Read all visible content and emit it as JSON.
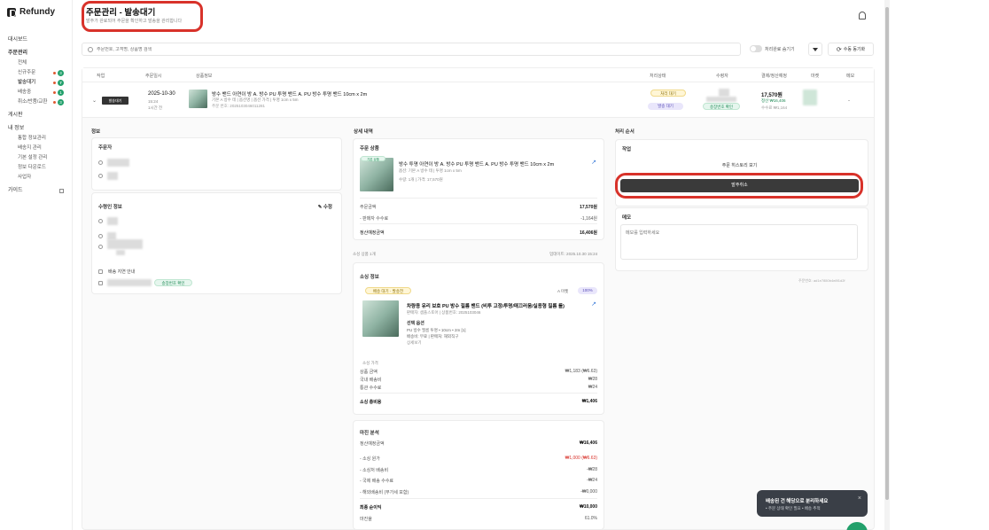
{
  "app": {
    "name": "Refundy"
  },
  "header": {
    "title": "주문관리 - 발송대기",
    "subtitle": "발주가 완료되어 주문을 확인하고 발송을 관리합니다"
  },
  "sidebar": {
    "items": [
      {
        "label": "대시보드"
      },
      {
        "label": "주문관리"
      },
      {
        "label": "전체"
      },
      {
        "label": "신규주문",
        "badge": "3"
      },
      {
        "label": "발송대기",
        "badge": "7"
      },
      {
        "label": "배송중",
        "badge": "1"
      },
      {
        "label": "취소/반품/교환",
        "badge": "3"
      },
      {
        "label": "게시판"
      },
      {
        "label": "내 정보"
      },
      {
        "label": "통합 정보관리"
      },
      {
        "label": "배송지 관리"
      },
      {
        "label": "기본 설정 관리"
      },
      {
        "label": "정보 다운로드"
      },
      {
        "label": "사업자"
      },
      {
        "label": "가이드"
      }
    ]
  },
  "toolbar": {
    "search_placeholder": "주문번호, 고객명, 상품명 검색",
    "toggle_label": "처리완료 숨기기",
    "refresh_label": "수동 동기화"
  },
  "table": {
    "headers": [
      "작업",
      "주문일시",
      "상품정보",
      "처리상태",
      "수령자",
      "결제/정산예정",
      "마켓",
      "메모"
    ],
    "row": {
      "status_button": "발송대기",
      "date": "2025-10-30",
      "date_sub1": "15:24",
      "date_sub2": "1시간 전",
      "product_name": "방수 밴드 아연이 방 A. 방수 PU 투명 밴드 A. PU 방수 투명 밴드 10cm x 2m",
      "product_sub": "기본 A 방수 테 | 옵션명 | 옵션 가격 | 투명 1cm x 5m",
      "product_sub2": "주문 번호: 2025103046011281",
      "pill_yellow": "처리 대기",
      "pill_lilac": "발송 대기",
      "pill_green": "송장번호 확인",
      "price": "17,570원",
      "price_sub1": "정산 ₩16,406",
      "price_sub2": "수수료 ₩1,164",
      "memo": "-"
    }
  },
  "detail": {
    "left_title": "정보",
    "orderer_title": "주문자",
    "receiver_title": "수령인 정보",
    "edit_label": "수정",
    "delivery_label": "배송 지연 안내",
    "delivery_pill": "송장번호 확인",
    "mid_title": "상세 내역",
    "order_item_title": "주문 상품",
    "order_item_badge": "기본 상품",
    "order_item_name": "방수 투명 아연이 방 A. 방수 PU 투명 밴드 A. PU 방수 투명 밴드 10cm x 2m",
    "order_item_sub": "옵션: 기본 A 방수 테 | 투명 1cm x 5m",
    "order_item_meta": "수량: 1개 | 가격: 17,570원",
    "order_total_label": "주문금액",
    "order_total": "17,570원",
    "fee_label": "- 판매자 수수료",
    "fee": "-1,164원",
    "settle_label": "정산예정금액",
    "settle": "16,406원",
    "source_label": "소싱 상품 1개",
    "source_time": "업데이트: 2025.10.30 15:24",
    "source_title": "소싱 정보",
    "source_badge": "배송 대기 · 발송전",
    "source_store": "A 마켓",
    "source_rate": "100%",
    "source_name": "차량용 유리 보호 PU 방수 필름 밴드 (비투 고정/투명/매끄러움/실용형 필름 롤)",
    "source_sub": "판매자: 샘플스토어 | 상품번호: 2025103046",
    "source_spec_title": "선택 옵션",
    "source_spec1": "PU 방수 필름 투명 • 10cm • 2m [1]",
    "source_spec2": "배송비: 무료 | 판매처: 해외직구",
    "source_spec3": "상세보기",
    "source_count": "소싱 가격",
    "source_price_label": "상품 금액",
    "source_price": "₩1,183 (₩6.63)",
    "source_ship_label": "국내 배송비",
    "source_ship": "₩28",
    "source_tax_label": "통관 수수료",
    "source_tax": "₩24",
    "source_total_label": "소싱 총비용",
    "source_total": "₩1,406",
    "profit_title": "마진 분석",
    "profit_settle_label": "정산예정금액",
    "profit_settle": "₩16,406",
    "profit_cost_label": "- 소싱 원가",
    "profit_cost": "₩1,000 (₩6.63)",
    "profit_c1_label": "- 소싱처 배송비",
    "profit_c1": "-₩28",
    "profit_c2_label": "- 국제 배송 수수료",
    "profit_c2": "-₩24",
    "profit_c3_label": "- 해외배송비 (부가세 포함)",
    "profit_c3": "-₩0,000",
    "profit_net_label": "최종 순이익",
    "profit_net": "₩10,000",
    "profit_rate_label": "마진율",
    "profit_rate": "61.0%",
    "right_title": "처리 순서",
    "work_title": "작업",
    "view_button": "주문 히스토리 보기",
    "reject_button": "발주취소",
    "memo_title": "메모",
    "memo_placeholder": "메모를 입력하세요",
    "order_id": "주문번호: ad1e7850b4e8f1d2f"
  },
  "toast": {
    "title": "배송된 건 해당으로 분리하세요",
    "sub": "• 주문 상태 확인 필요 • 배송 추적"
  },
  "colors": {
    "accent": "#d8322a",
    "success": "#22a06b",
    "dark": "#3a3a3a"
  }
}
